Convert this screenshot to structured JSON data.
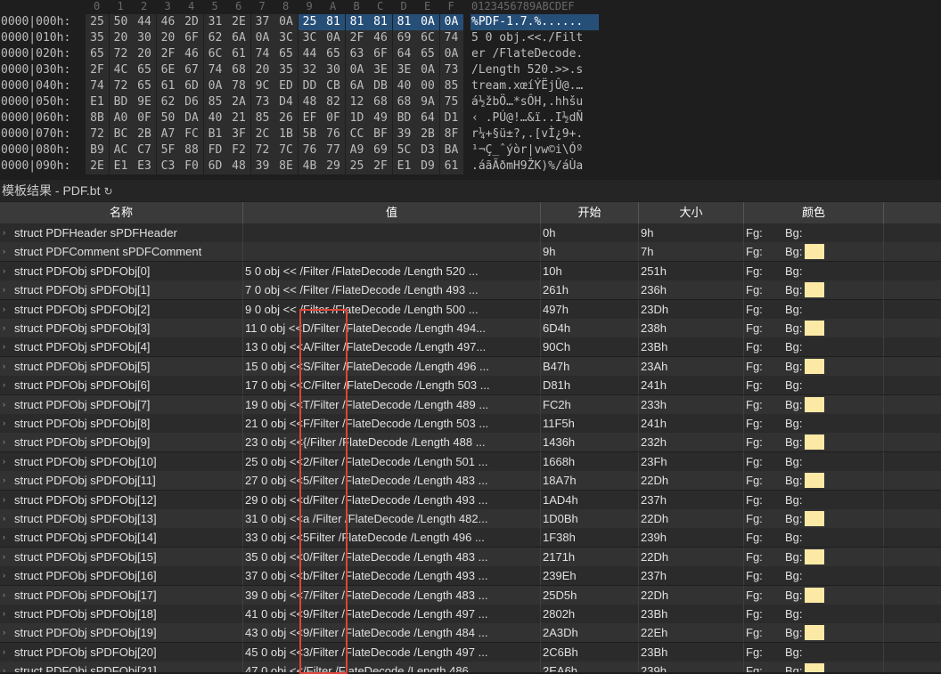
{
  "hex": {
    "col_header": [
      "0",
      "1",
      "2",
      "3",
      "4",
      "5",
      "6",
      "7",
      "8",
      "9",
      "A",
      "B",
      "C",
      "D",
      "E",
      "F"
    ],
    "ascii_header": "0123456789ABCDEF",
    "rows": [
      {
        "addr": "0000|000h:",
        "bytes": [
          "25",
          "50",
          "44",
          "46",
          "2D",
          "31",
          "2E",
          "37",
          "0A",
          "25",
          "81",
          "81",
          "81",
          "81",
          "0A",
          "0A"
        ],
        "ascii": "%PDF-1.7.%......"
      },
      {
        "addr": "0000|010h:",
        "bytes": [
          "35",
          "20",
          "30",
          "20",
          "6F",
          "62",
          "6A",
          "0A",
          "3C",
          "3C",
          "0A",
          "2F",
          "46",
          "69",
          "6C",
          "74"
        ],
        "ascii": "5 0 obj.<<./Filt"
      },
      {
        "addr": "0000|020h:",
        "bytes": [
          "65",
          "72",
          "20",
          "2F",
          "46",
          "6C",
          "61",
          "74",
          "65",
          "44",
          "65",
          "63",
          "6F",
          "64",
          "65",
          "0A"
        ],
        "ascii": "er /FlateDecode."
      },
      {
        "addr": "0000|030h:",
        "bytes": [
          "2F",
          "4C",
          "65",
          "6E",
          "67",
          "74",
          "68",
          "20",
          "35",
          "32",
          "30",
          "0A",
          "3E",
          "3E",
          "0A",
          "73"
        ],
        "ascii": "/Length 520.>>.s"
      },
      {
        "addr": "0000|040h:",
        "bytes": [
          "74",
          "72",
          "65",
          "61",
          "6D",
          "0A",
          "78",
          "9C",
          "ED",
          "DD",
          "CB",
          "6A",
          "DB",
          "40",
          "00",
          "85"
        ],
        "ascii": "tream.xœíÝËjÛ@.…"
      },
      {
        "addr": "0000|050h:",
        "bytes": [
          "E1",
          "BD",
          "9E",
          "62",
          "D6",
          "85",
          "2A",
          "73",
          "D4",
          "48",
          "82",
          "12",
          "68",
          "68",
          "9A",
          "75"
        ],
        "ascii": "á½žbÖ…*sÔH‚.hhšu"
      },
      {
        "addr": "0000|060h:",
        "bytes": [
          "8B",
          "A0",
          "0F",
          "50",
          "DA",
          "40",
          "21",
          "85",
          "26",
          "EF",
          "0F",
          "1D",
          "49",
          "BD",
          "64",
          "D1"
        ],
        "ascii": "‹ .PÚ@!…&ï..I½dÑ"
      },
      {
        "addr": "0000|070h:",
        "bytes": [
          "72",
          "BC",
          "2B",
          "A7",
          "FC",
          "B1",
          "3F",
          "2C",
          "1B",
          "5B",
          "76",
          "CC",
          "BF",
          "39",
          "2B",
          "8F"
        ],
        "ascii": "r¼+§ü±?,.[vÌ¿9+."
      },
      {
        "addr": "0000|080h:",
        "bytes": [
          "B9",
          "AC",
          "C7",
          "5F",
          "88",
          "FD",
          "F2",
          "72",
          "7C",
          "76",
          "77",
          "A9",
          "69",
          "5C",
          "D3",
          "BA"
        ],
        "ascii": "¹¬Ç_ˆýòr|vw©i\\Óº"
      },
      {
        "addr": "0000|090h:",
        "bytes": [
          "2E",
          "E1",
          "E3",
          "C3",
          "F0",
          "6D",
          "48",
          "39",
          "8E",
          "4B",
          "29",
          "25",
          "2F",
          "E1",
          "D9",
          "61"
        ],
        "ascii": ".áãÃðmH9ŽK)%/áÙa"
      }
    ]
  },
  "results": {
    "title": "模板结果 - PDF.bt",
    "columns": {
      "name": "名称",
      "value": "值",
      "start": "开始",
      "size": "大小",
      "color": "颜色"
    },
    "fg_label": "Fg:",
    "bg_label": "Bg:",
    "swatch_color": "#fde9a6",
    "rows": [
      {
        "name": "struct PDFHeader sPDFHeader",
        "value": "",
        "start": "0h",
        "size": "9h",
        "swatch": false
      },
      {
        "name": "struct PDFComment sPDFComment",
        "value": "",
        "start": "9h",
        "size": "7h",
        "swatch": true
      },
      {
        "name": "struct PDFObj sPDFObj[0]",
        "value": "5 0 obj  << /Filter /FlateDecode /Length 520 ...",
        "start": "10h",
        "size": "251h",
        "swatch": false
      },
      {
        "name": "struct PDFObj sPDFObj[1]",
        "value": "7 0 obj  << /Filter /FlateDecode /Length 493 ...",
        "start": "261h",
        "size": "236h",
        "swatch": true
      },
      {
        "name": "struct PDFObj sPDFObj[2]",
        "value": "9 0 obj  << /Filter /FlateDecode /Length 500 ...",
        "start": "497h",
        "size": "23Dh",
        "swatch": false
      },
      {
        "name": "struct PDFObj sPDFObj[3]",
        "value": "11 0 obj  <<D/Filter /FlateDecode /Length 494...",
        "start": "6D4h",
        "size": "238h",
        "swatch": true
      },
      {
        "name": "struct PDFObj sPDFObj[4]",
        "value": "13 0 obj  <<A/Filter /FlateDecode /Length 497...",
        "start": "90Ch",
        "size": "23Bh",
        "swatch": false
      },
      {
        "name": "struct PDFObj sPDFObj[5]",
        "value": "15 0 obj  <<S/Filter /FlateDecode /Length 496 ...",
        "start": "B47h",
        "size": "23Ah",
        "swatch": true
      },
      {
        "name": "struct PDFObj sPDFObj[6]",
        "value": "17 0 obj  <<C/Filter /FlateDecode /Length 503 ...",
        "start": "D81h",
        "size": "241h",
        "swatch": false
      },
      {
        "name": "struct PDFObj sPDFObj[7]",
        "value": "19 0 obj  <<T/Filter /FlateDecode /Length 489 ...",
        "start": "FC2h",
        "size": "233h",
        "swatch": true
      },
      {
        "name": "struct PDFObj sPDFObj[8]",
        "value": "21 0 obj  <<F/Filter /FlateDecode /Length 503 ...",
        "start": "11F5h",
        "size": "241h",
        "swatch": false
      },
      {
        "name": "struct PDFObj sPDFObj[9]",
        "value": "23 0 obj  <<{/Filter /FlateDecode /Length 488 ...",
        "start": "1436h",
        "size": "232h",
        "swatch": true
      },
      {
        "name": "struct PDFObj sPDFObj[10]",
        "value": "25 0 obj  <<2/Filter /FlateDecode /Length 501 ...",
        "start": "1668h",
        "size": "23Fh",
        "swatch": false
      },
      {
        "name": "struct PDFObj sPDFObj[11]",
        "value": "27 0 obj  <<5/Filter /FlateDecode /Length 483 ...",
        "start": "18A7h",
        "size": "22Dh",
        "swatch": true
      },
      {
        "name": "struct PDFObj sPDFObj[12]",
        "value": "29 0 obj  <<d/Filter /FlateDecode /Length 493 ...",
        "start": "1AD4h",
        "size": "237h",
        "swatch": false
      },
      {
        "name": "struct PDFObj sPDFObj[13]",
        "value": "31 0 obj  <<a /Filter /FlateDecode /Length 482...",
        "start": "1D0Bh",
        "size": "22Dh",
        "swatch": true
      },
      {
        "name": "struct PDFObj sPDFObj[14]",
        "value": "33 0 obj  <<5Filter /FlateDecode /Length 496 ...",
        "start": "1F38h",
        "size": "239h",
        "swatch": false
      },
      {
        "name": "struct PDFObj sPDFObj[15]",
        "value": "35 0 obj  <<0/Filter /FlateDecode /Length 483 ...",
        "start": "2171h",
        "size": "22Dh",
        "swatch": true
      },
      {
        "name": "struct PDFObj sPDFObj[16]",
        "value": "37 0 obj  <<b/Filter /FlateDecode /Length 493 ...",
        "start": "239Eh",
        "size": "237h",
        "swatch": false
      },
      {
        "name": "struct PDFObj sPDFObj[17]",
        "value": "39 0 obj  <<7/Filter /FlateDecode /Length 483 ...",
        "start": "25D5h",
        "size": "22Dh",
        "swatch": true
      },
      {
        "name": "struct PDFObj sPDFObj[18]",
        "value": "41 0 obj  <<9/Filter /FlateDecode /Length 497 ...",
        "start": "2802h",
        "size": "23Bh",
        "swatch": false
      },
      {
        "name": "struct PDFObj sPDFObj[19]",
        "value": "43 0 obj  <<9/Filter /FlateDecode /Length 484 ...",
        "start": "2A3Dh",
        "size": "22Eh",
        "swatch": true
      },
      {
        "name": "struct PDFObj sPDFObj[20]",
        "value": "45 0 obj  <<3/Filter /FlateDecode /Length 497 ...",
        "start": "2C6Bh",
        "size": "23Bh",
        "swatch": false
      },
      {
        "name": "struct PDFObj sPDFObj[21]",
        "value": "47 0 obj  <</Filter /FlateDecode /Length 486 ...",
        "start": "2EA6h",
        "size": "239h",
        "swatch": true
      }
    ]
  }
}
